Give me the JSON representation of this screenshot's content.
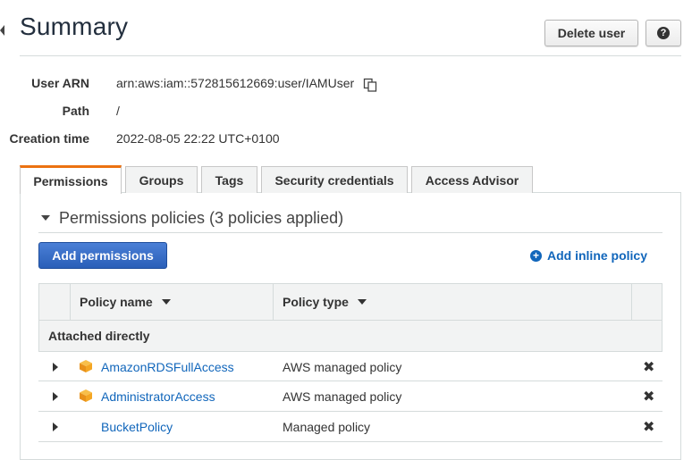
{
  "header": {
    "title": "Summary",
    "delete_user_label": "Delete user",
    "help_glyph": "?"
  },
  "summary": {
    "user_arn_label": "User ARN",
    "user_arn_value": "arn:aws:iam::572815612669:user/IAMUser",
    "path_label": "Path",
    "path_value": "/",
    "creation_label": "Creation time",
    "creation_value": "2022-08-05 22:22 UTC+0100"
  },
  "tabs": [
    {
      "label": "Permissions",
      "active": true
    },
    {
      "label": "Groups",
      "active": false
    },
    {
      "label": "Tags",
      "active": false
    },
    {
      "label": "Security credentials",
      "active": false
    },
    {
      "label": "Access Advisor",
      "active": false
    }
  ],
  "permissions": {
    "section_title": "Permissions policies (3 policies applied)",
    "add_permissions_label": "Add permissions",
    "add_inline_policy_label": "Add inline policy",
    "columns": {
      "policy_name": "Policy name",
      "policy_type": "Policy type"
    },
    "group_label": "Attached directly",
    "policies": [
      {
        "name": "AmazonRDSFullAccess",
        "type": "AWS managed policy",
        "icon": "aws-managed-cube-icon"
      },
      {
        "name": "AdministratorAccess",
        "type": "AWS managed policy",
        "icon": "aws-managed-cube-icon"
      },
      {
        "name": "BucketPolicy",
        "type": "Managed policy",
        "icon": ""
      }
    ],
    "remove_glyph": "✖"
  },
  "colors": {
    "accent_tab": "#ec7211",
    "link": "#1166bb",
    "primary_button": "#2a5fb8",
    "aws_cube": "#f4a623"
  }
}
